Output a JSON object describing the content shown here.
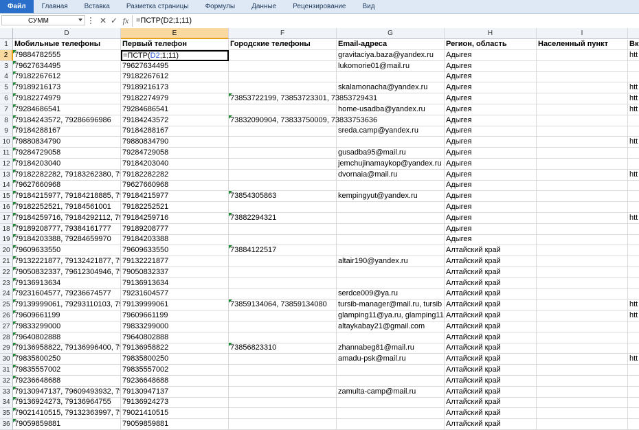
{
  "ribbon_tabs": [
    "Файл",
    "Главная",
    "Вставка",
    "Разметка страницы",
    "Формулы",
    "Данные",
    "Рецензирование",
    "Вид"
  ],
  "formula_bar": {
    "name_box": "СУММ",
    "cancel_icon": "✕",
    "enter_icon": "✓",
    "fx_icon": "fx",
    "formula": "=ПСТР(D2;1;11)"
  },
  "columns": [
    "D",
    "E",
    "F",
    "G",
    "H",
    "I"
  ],
  "partial_column": "",
  "active_cell": {
    "row": "2",
    "col": "E",
    "formula_prefix": "=ПСТР(",
    "formula_ref": "D2",
    "formula_suffix": ";1;11)"
  },
  "header_row": {
    "num": "1",
    "D": "Мобильные телефоны",
    "E": "Первый телефон",
    "F": "Городские телефоны",
    "G": "Email-адреса",
    "H": "Регион, область",
    "I": "Населенный пункт",
    "J": "Вк"
  },
  "rows": [
    {
      "num": "2",
      "D": "79884782555",
      "E": "",
      "F": "",
      "G": "gravitaciya.baza@yandex.ru",
      "H": "Адыгея",
      "J": "htt"
    },
    {
      "num": "3",
      "D": "79627634495",
      "E": "79627634495",
      "F": "",
      "G": "lukomorie01@mail.ru",
      "H": "Адыгея",
      "J": ""
    },
    {
      "num": "4",
      "D": "79182267612",
      "E": "79182267612",
      "F": "",
      "G": "",
      "H": "Адыгея",
      "J": ""
    },
    {
      "num": "5",
      "D": "79189216173",
      "E": "79189216173",
      "F": "",
      "G": "skalamonacha@yandex.ru",
      "H": "Адыгея",
      "J": "htt"
    },
    {
      "num": "6",
      "D": "79182274979",
      "E": "79182274979",
      "F": "73853722199, 73853723301, 73853729431",
      "G": "",
      "H": "Адыгея",
      "J": "htt"
    },
    {
      "num": "7",
      "D": "79284686541",
      "E": "79284686541",
      "F": "",
      "G": "home-usadba@yandex.ru",
      "H": "Адыгея",
      "J": "htt"
    },
    {
      "num": "8",
      "D": "79184243572, 79286696986",
      "E": "79184243572",
      "F": "73832090904, 73833750009, 73833753636",
      "G": "",
      "H": "Адыгея",
      "J": ""
    },
    {
      "num": "9",
      "D": "79184288167",
      "E": "79184288167",
      "F": "",
      "G": "sreda.camp@yandex.ru",
      "H": "Адыгея",
      "J": ""
    },
    {
      "num": "10",
      "D": "79880834790",
      "E": "79880834790",
      "F": "",
      "G": "",
      "H": "Адыгея",
      "J": "htt"
    },
    {
      "num": "11",
      "D": "79284729058",
      "E": "79284729058",
      "F": "",
      "G": "gusadba95@mail.ru",
      "H": "Адыгея",
      "J": ""
    },
    {
      "num": "12",
      "D": "79184203040",
      "E": "79184203040",
      "F": "",
      "G": "jemchujinamaykop@yandex.ru",
      "H": "Адыгея",
      "J": ""
    },
    {
      "num": "13",
      "D": "79182282282, 79183262380, 7928",
      "E": "79182282282",
      "F": "",
      "G": "dvornaia@mail.ru",
      "H": "Адыгея",
      "J": "htt"
    },
    {
      "num": "14",
      "D": "79627660968",
      "E": "79627660968",
      "F": "",
      "G": "",
      "H": "Адыгея",
      "J": ""
    },
    {
      "num": "15",
      "D": "79184215977, 79184218885, 7918",
      "E": "79184215977",
      "F": "73854305863",
      "G": "kempingyut@yandex.ru",
      "H": "Адыгея",
      "J": ""
    },
    {
      "num": "16",
      "D": "79182252521, 79184561001",
      "E": "79182252521",
      "F": "",
      "G": "",
      "H": "Адыгея",
      "J": ""
    },
    {
      "num": "17",
      "D": "79184259716, 79184292112, 7928",
      "E": "79184259716",
      "F": "73882294321",
      "G": "",
      "H": "Адыгея",
      "J": "htt"
    },
    {
      "num": "18",
      "D": "79189208777, 79384161777",
      "E": "79189208777",
      "F": "",
      "G": "",
      "H": "Адыгея",
      "J": ""
    },
    {
      "num": "19",
      "D": "79184203388, 79284659970",
      "E": "79184203388",
      "F": "",
      "G": "",
      "H": "Адыгея",
      "J": ""
    },
    {
      "num": "20",
      "D": "79609633550",
      "E": "79609633550",
      "F": "73884122517",
      "G": "",
      "H": "Алтайский край",
      "J": ""
    },
    {
      "num": "21",
      "D": "79132221877, 79132421877, 7923",
      "E": "79132221877",
      "F": "",
      "G": "altair190@yandex.ru",
      "H": "Алтайский край",
      "J": ""
    },
    {
      "num": "22",
      "D": "79050832337, 79612304946, 7961",
      "E": "79050832337",
      "F": "",
      "G": "",
      "H": "Алтайский край",
      "J": ""
    },
    {
      "num": "23",
      "D": "79136913634",
      "E": "79136913634",
      "F": "",
      "G": "",
      "H": "Алтайский край",
      "J": ""
    },
    {
      "num": "24",
      "D": "79231604577, 79236674577",
      "E": "79231604577",
      "F": "",
      "G": "serdce009@ya.ru",
      "H": "Алтайский край",
      "J": ""
    },
    {
      "num": "25",
      "D": "79139999061, 79293110103, 7929",
      "E": "79139999061",
      "F": "73859134064, 73859134080",
      "G": "tursib-manager@mail.ru, tursib",
      "H": "Алтайский край",
      "J": "htt"
    },
    {
      "num": "26",
      "D": "79609661199",
      "E": "79609661199",
      "F": "",
      "G": "glamping11@ya.ru, glamping11@",
      "H": "Алтайский край",
      "J": "htt"
    },
    {
      "num": "27",
      "D": "79833299000",
      "E": "79833299000",
      "F": "",
      "G": "altaykabay21@gmail.com",
      "H": "Алтайский край",
      "J": ""
    },
    {
      "num": "28",
      "D": "79640802888",
      "E": "79640802888",
      "F": "",
      "G": "",
      "H": "Алтайский край",
      "J": ""
    },
    {
      "num": "29",
      "D": "79136958822, 79136996400, 7913",
      "E": "79136958822",
      "F": "73856823310",
      "G": "zhannabeg81@mail.ru",
      "H": "Алтайский край",
      "J": ""
    },
    {
      "num": "30",
      "D": "79835800250",
      "E": "79835800250",
      "F": "",
      "G": "amadu-psk@mail.ru",
      "H": "Алтайский край",
      "J": "htt"
    },
    {
      "num": "31",
      "D": "79835557002",
      "E": "79835557002",
      "F": "",
      "G": "",
      "H": "Алтайский край",
      "J": ""
    },
    {
      "num": "32",
      "D": "79236648688",
      "E": "79236648688",
      "F": "",
      "G": "",
      "H": "Алтайский край",
      "J": ""
    },
    {
      "num": "33",
      "D": "79130947137, 79609493932, 7983",
      "E": "79130947137",
      "F": "",
      "G": "zamulta-camp@mail.ru",
      "H": "Алтайский край",
      "J": ""
    },
    {
      "num": "34",
      "D": "79136924273, 79136964755",
      "E": "79136924273",
      "F": "",
      "G": "",
      "H": "Алтайский край",
      "J": ""
    },
    {
      "num": "35",
      "D": "79021410515, 79132363997, 7996",
      "E": "79021410515",
      "F": "",
      "G": "",
      "H": "Алтайский край",
      "J": ""
    },
    {
      "num": "36",
      "D": "79059859881",
      "E": "79059859881",
      "F": "",
      "G": "",
      "H": "Алтайский край",
      "J": ""
    }
  ]
}
